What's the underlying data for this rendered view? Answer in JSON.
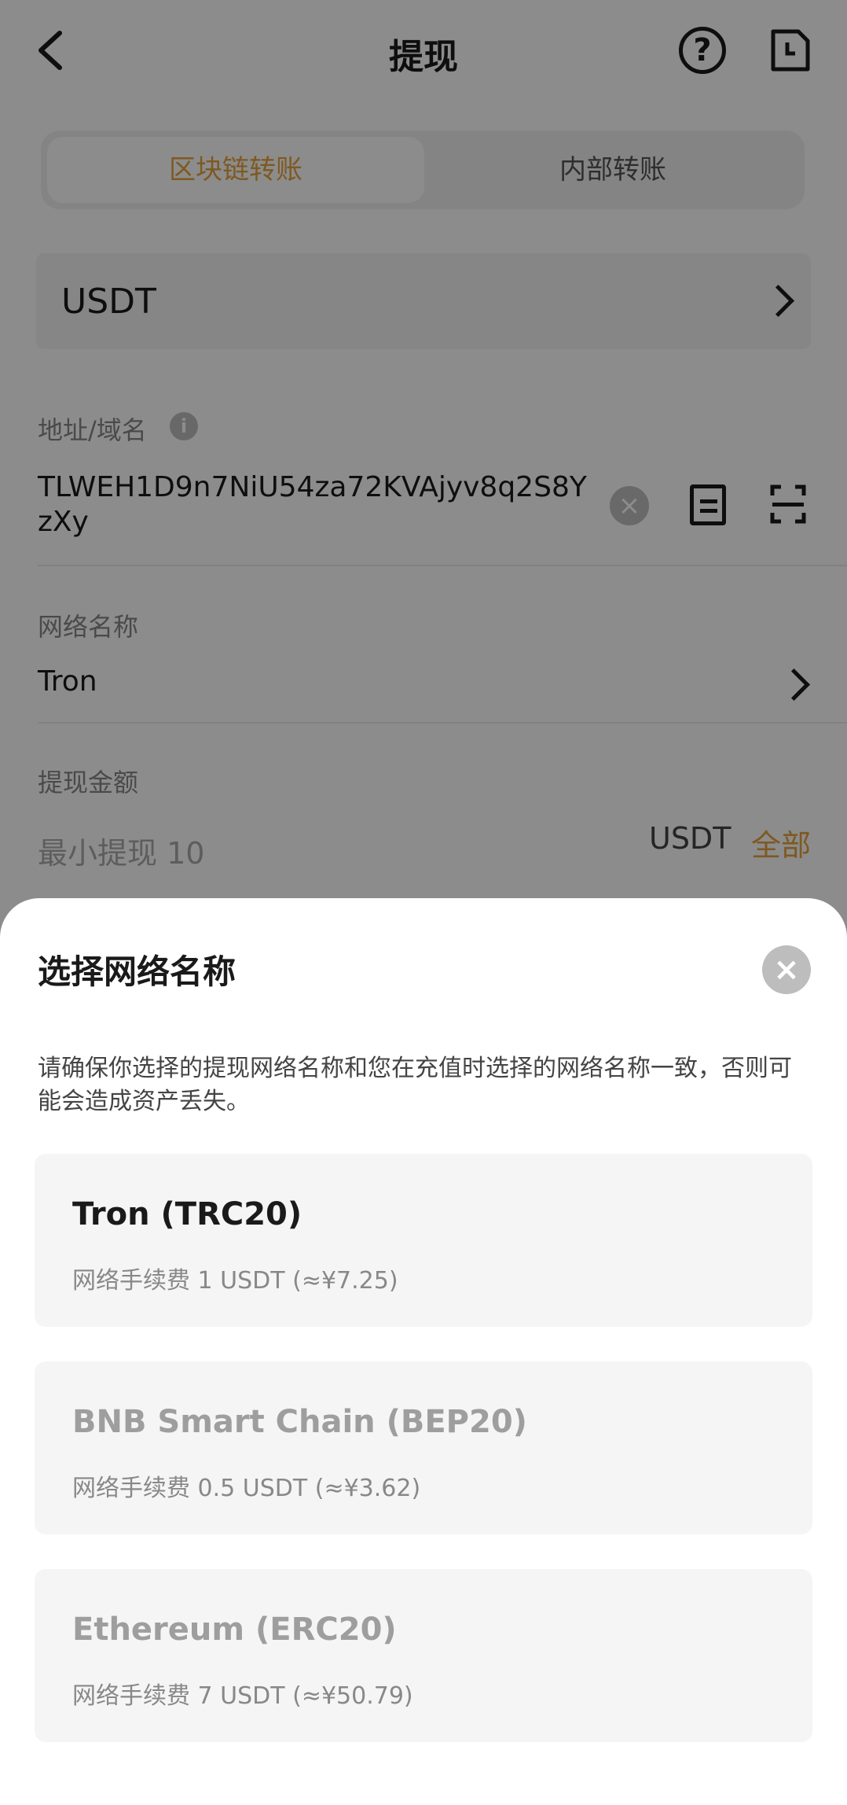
{
  "header": {
    "title": "提现",
    "help_icon": "?"
  },
  "tabs": [
    {
      "label": "区块链转账",
      "active": true
    },
    {
      "label": "内部转账",
      "active": false
    }
  ],
  "coin": {
    "label": "USDT"
  },
  "address": {
    "label": "地址/域名",
    "info": "i",
    "value": "TLWEH1D9n7NiU54za72KVAjyv8q2S8YzXy",
    "clear": "×"
  },
  "network": {
    "label": "网络名称",
    "value": "Tron"
  },
  "amount": {
    "label": "提现金额",
    "placeholder": "最小提现 10",
    "unit": "USDT",
    "all": "全部"
  },
  "sheet": {
    "title": "选择网络名称",
    "close": "×",
    "note": "请确保你选择的提现网络名称和您在充值时选择的网络名称一致，否则可能会造成资产丢失。",
    "options": [
      {
        "name": "Tron (TRC20)",
        "fee": "网络手续费 1 USDT (≈¥7.25)",
        "enabled": true
      },
      {
        "name": "BNB Smart Chain (BEP20)",
        "fee": "网络手续费 0.5 USDT (≈¥3.62)",
        "enabled": false
      },
      {
        "name": "Ethereum (ERC20)",
        "fee": "网络手续费 7 USDT (≈¥50.79)",
        "enabled": false
      }
    ]
  },
  "colors": {
    "accent": "#e6a23c",
    "overlay": "rgba(0,0,0,0.45)"
  }
}
